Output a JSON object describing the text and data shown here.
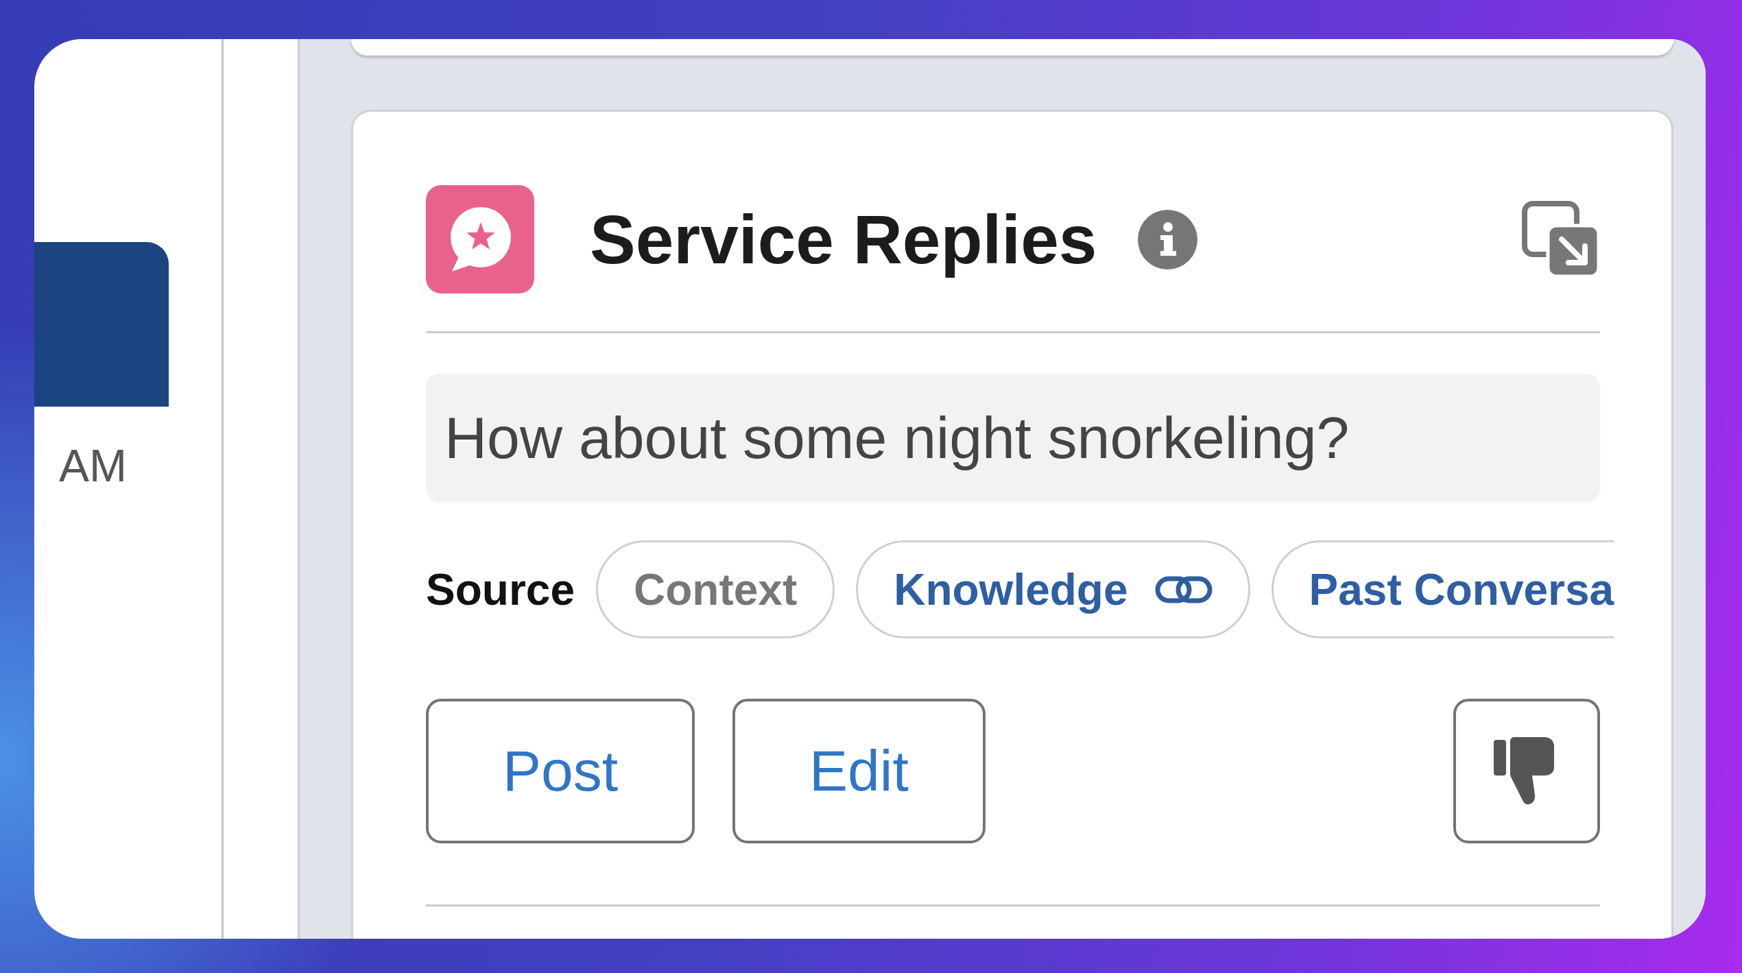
{
  "conversation": {
    "time": "AM"
  },
  "card": {
    "title": "Service Replies",
    "reply": {
      "value": "How about some night snorkeling?"
    },
    "source": {
      "label": "Source",
      "chips": [
        {
          "label": "Context",
          "kind": "text",
          "disabled": true
        },
        {
          "label": "Knowledge",
          "kind": "link",
          "disabled": false
        },
        {
          "label": "Past Conversa",
          "kind": "text",
          "disabled": false
        }
      ]
    },
    "actions": [
      {
        "label": "Post"
      },
      {
        "label": "Edit"
      }
    ]
  }
}
